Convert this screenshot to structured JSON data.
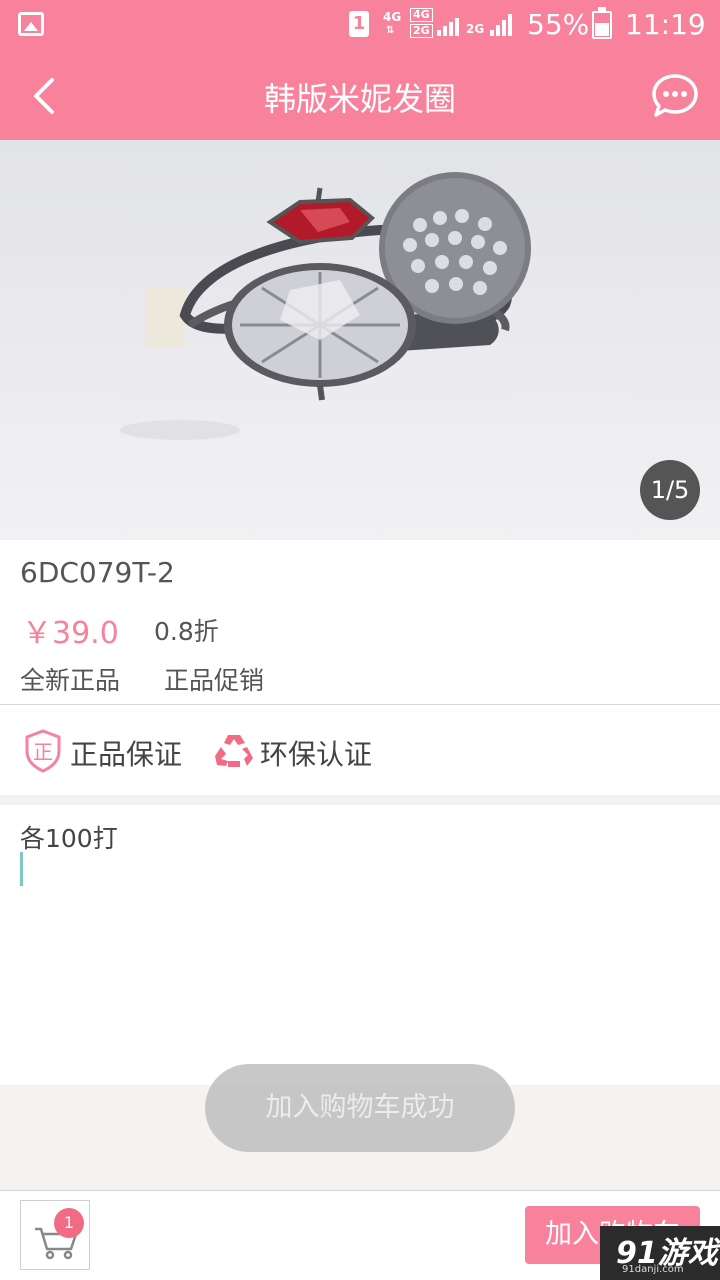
{
  "status_bar": {
    "sim_slot": "1",
    "network_1": "4G",
    "network_2_top": "4G",
    "network_2_bottom": "2G",
    "network_3": "2G",
    "battery_percent": "55%",
    "time": "11:19"
  },
  "header": {
    "title": "韩版米妮发圈"
  },
  "gallery": {
    "counter": "1/5"
  },
  "product": {
    "sku": "6DC079T-2",
    "price": "￥39.0",
    "discount": "0.8折",
    "tags": [
      "全新正品",
      "正品促销"
    ]
  },
  "guarantees": [
    {
      "label": "正品保证",
      "icon": "authentic-shield-icon",
      "icon_char": "正"
    },
    {
      "label": "环保认证",
      "icon": "recycle-icon"
    }
  ],
  "description": "各100打",
  "toast": "加入购物车成功",
  "bottom_bar": {
    "cart_count": "1",
    "add_label": "加入购物车"
  },
  "watermark": {
    "logo": "91游戏",
    "url": "91danji.com"
  },
  "colors": {
    "brand_pink": "#f8829c",
    "price_pink": "#f5839c",
    "badge": "#f26b85",
    "cursor_teal": "#7fc7c4"
  }
}
